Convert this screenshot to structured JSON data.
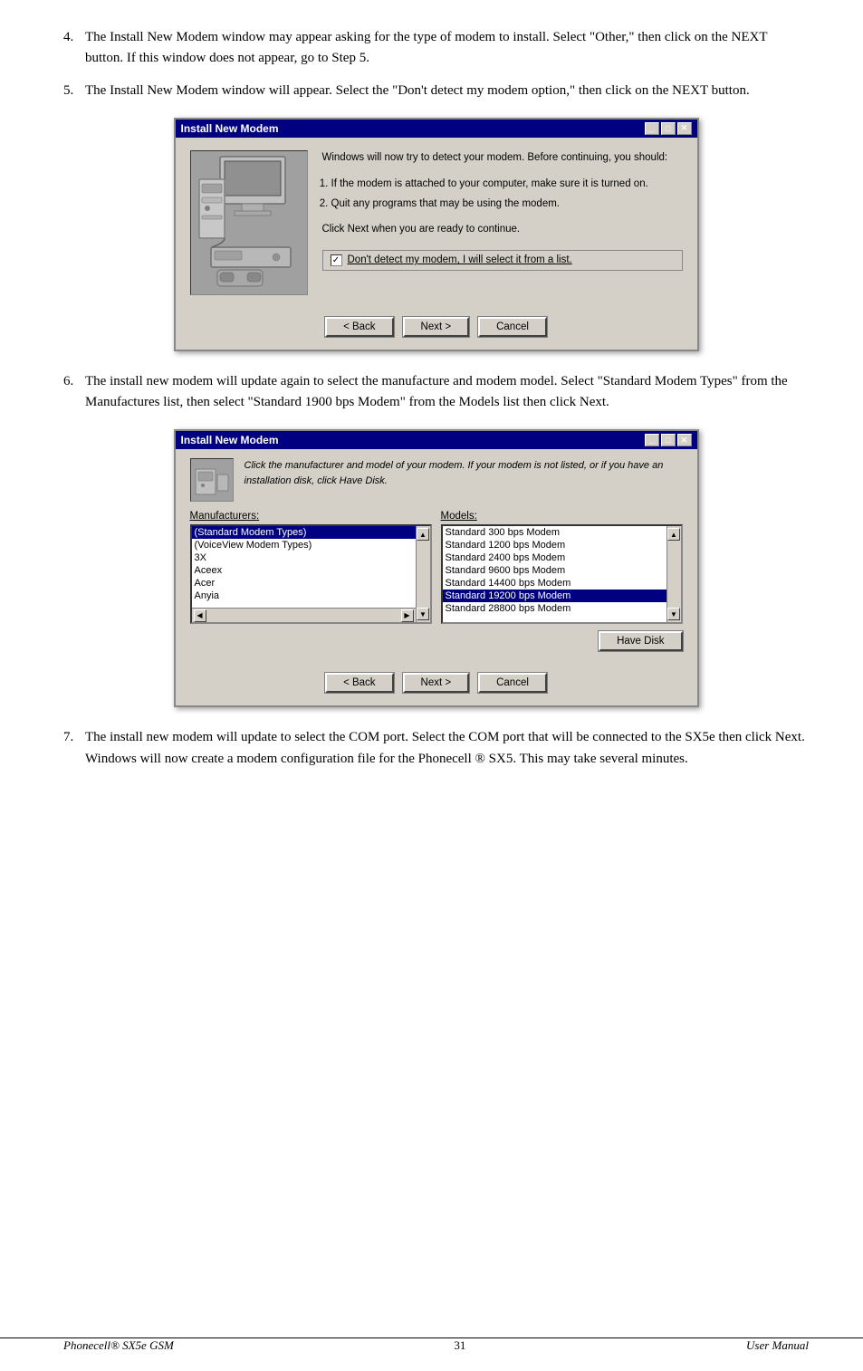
{
  "steps": [
    {
      "num": "4.",
      "text": "The Install New Modem window may appear asking for the type of modem to install. Select \"Other,\" then click on the NEXT button. If this window does not appear, go to Step 5."
    },
    {
      "num": "5.",
      "text": "The Install New Modem window will appear. Select the \"Don't detect my modem option,\" then click on the NEXT button."
    },
    {
      "num": "6.",
      "text": "The install new modem will update again to select the manufacture and modem model. Select \"Standard Modem Types\" from the Manufactures list, then select \"Standard 1900 bps Modem\" from the Models list then click Next."
    },
    {
      "num": "7.",
      "text": "The install new modem will update to select the COM port.  Select the COM port that will be connected to the SX5e then click Next. Windows will now create a modem configuration file for the Phonecell ® SX5. This may take several minutes."
    }
  ],
  "dialog1": {
    "title": "Install New Modem",
    "heading_text": "Windows will now try to detect your modem.  Before continuing, you should:",
    "list_items": [
      "If the modem is attached to your computer, make sure it is turned on.",
      "Quit any programs that may be using the modem."
    ],
    "footer_text": "Click Next when you are ready to continue.",
    "checkbox_label": "Don't detect my modem, I will select it from a list.",
    "btn_back": "< Back",
    "btn_next": "Next >",
    "btn_cancel": "Cancel"
  },
  "dialog2": {
    "title": "Install New Modem",
    "inst_text": "Click the manufacturer and model of your modem. If your modem is not listed, or if you have an installation disk, click Have Disk.",
    "manufacturers_label": "Manufacturers:",
    "manufacturers": [
      "(Standard Modem Types)",
      "(VoiceView Modem Types)",
      "3X",
      "Aceex",
      "Acer",
      "Anyia"
    ],
    "manufacturers_selected": "(Standard Modem Types)",
    "models_label": "Models:",
    "models": [
      "Standard  300 bps Modem",
      "Standard 1200 bps Modem",
      "Standard 2400 bps Modem",
      "Standard 9600 bps Modem",
      "Standard 14400 bps Modem",
      "Standard 19200 bps Modem",
      "Standard 28800 bps Modem"
    ],
    "models_selected": "Standard 19200 bps Modem",
    "btn_have_disk": "Have Disk",
    "btn_back": "< Back",
    "btn_next": "Next >",
    "btn_cancel": "Cancel"
  },
  "footer": {
    "left": "Phonecell® SX5e GSM",
    "center": "31",
    "right": "User Manual"
  }
}
